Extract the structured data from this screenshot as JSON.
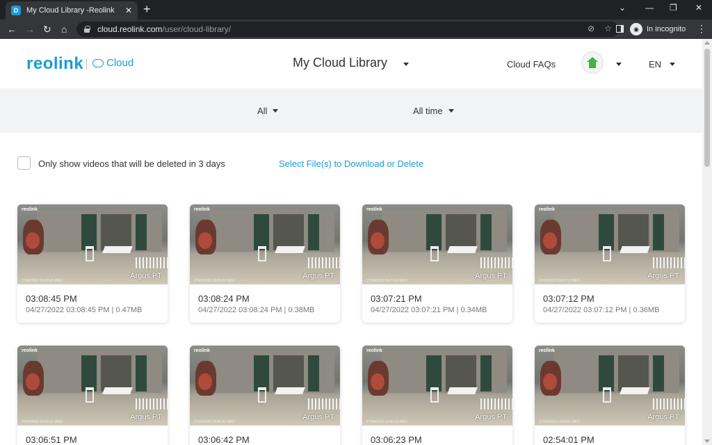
{
  "browser": {
    "tab_title": "My Cloud Library -Reolink",
    "url_host": "cloud.reolink.com",
    "url_path": "/user/cloud-library/",
    "incognito_label": "In incognito"
  },
  "header": {
    "logo_text": "reolink",
    "cloud_label": "Cloud",
    "title": "My Cloud Library",
    "faqs": "Cloud FAQs",
    "language": "EN"
  },
  "filters": {
    "device": "All",
    "time": "All time"
  },
  "options": {
    "checkbox_label": "Only show videos that will be deleted in 3 days",
    "checkbox_checked": false,
    "select_link": "Select File(s) to Download or Delete"
  },
  "colors": {
    "accent": "#1a9bd7",
    "avatar_green": "#3cb44a"
  },
  "cards": [
    {
      "time": "03:08:45 PM",
      "meta": "04/27/2022 03:08:45 PM | 0.47MB",
      "camera": "Argus PT",
      "brand": "reolink",
      "stamp": "27/04/2022 15:08:45 WED"
    },
    {
      "time": "03:08:24 PM",
      "meta": "04/27/2022 03:08:24 PM | 0.38MB",
      "camera": "Argus PT",
      "brand": "reolink",
      "stamp": "27/04/2022 15:08:24 WED"
    },
    {
      "time": "03:07:21 PM",
      "meta": "04/27/2022 03:07:21 PM | 0.34MB",
      "camera": "Argus PT",
      "brand": "reolink",
      "stamp": "27/04/2022 15:07:21 WED"
    },
    {
      "time": "03:07:12 PM",
      "meta": "04/27/2022 03:07:12 PM | 0.36MB",
      "camera": "Argus PT",
      "brand": "reolink",
      "stamp": "27/04/2022 15:07:12 WED"
    },
    {
      "time": "03:06:51 PM",
      "meta": "",
      "camera": "Argus PT",
      "brand": "reolink",
      "stamp": "27/04/2022 15:06:51 WED"
    },
    {
      "time": "03:06:42 PM",
      "meta": "",
      "camera": "Argus PT",
      "brand": "reolink",
      "stamp": "27/04/2022 15:06:42 WED"
    },
    {
      "time": "03:06:23 PM",
      "meta": "",
      "camera": "Argus PT",
      "brand": "reolink",
      "stamp": "27/04/2022 15:06:23 WED"
    },
    {
      "time": "02:54:01 PM",
      "meta": "",
      "camera": "Argus PT",
      "brand": "reolink",
      "stamp": "27/04/2022 14:54:01 WED"
    }
  ]
}
